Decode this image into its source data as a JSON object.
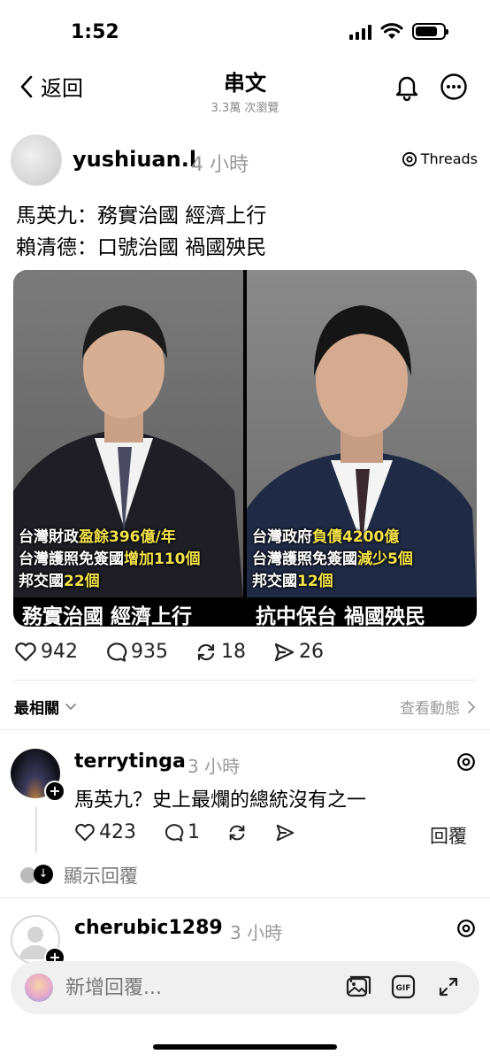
{
  "status_bar": {
    "time": "1:52"
  },
  "nav": {
    "back_label": "返回",
    "title": "串文",
    "subtitle": "3.3萬 次瀏覽"
  },
  "post": {
    "username": "yushiuan.l",
    "time": "4 小時",
    "threads_label": "Threads",
    "text_lines": [
      "馬英九：務實治國 經濟上行",
      "賴清德：口號治國 禍國殃民"
    ],
    "image": {
      "left_caption": [
        {
          "plain": "台灣財政",
          "highlight": "盈餘396億/年",
          "tail": ""
        },
        {
          "plain": "台灣護照免簽國",
          "highlight": "增加110個",
          "tail": ""
        },
        {
          "plain": "邦交國",
          "highlight": "22個",
          "tail": ""
        }
      ],
      "right_caption": [
        {
          "plain": "台灣政府",
          "highlight": "負債4200億",
          "tail": ""
        },
        {
          "plain": "台灣護照免簽國",
          "highlight": "減少5個",
          "tail": ""
        },
        {
          "plain": "邦交國",
          "highlight": "12個",
          "tail": ""
        }
      ],
      "left_banner": "務實治國 經濟上行",
      "right_banner": "抗中保台 禍國殃民"
    },
    "stats": {
      "likes": "942",
      "comments": "935",
      "reposts": "18",
      "shares": "26"
    }
  },
  "sort": {
    "label": "最相關",
    "activity": "查看動態"
  },
  "comments": [
    {
      "username": "terrytinga",
      "time": "3 小時",
      "text": "馬英九？史上最爛的總統沒有之一",
      "likes": "423",
      "replies_count": "1",
      "reply_label": "回覆",
      "show_replies": "顯示回覆"
    },
    {
      "username": "cherubic1289",
      "time": "3 小時"
    }
  ],
  "compose": {
    "placeholder": "新增回覆..."
  },
  "colors": {
    "highlight": "#f2e24a",
    "muted": "#999999"
  }
}
